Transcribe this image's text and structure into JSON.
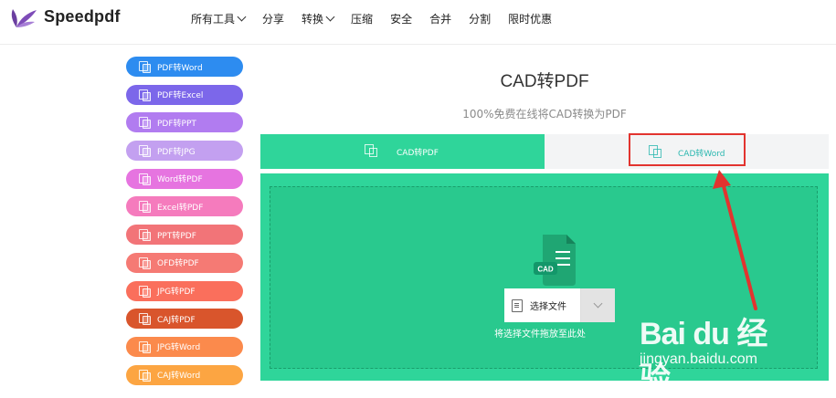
{
  "header": {
    "brand": "Speedpdf",
    "nav": [
      {
        "label": "所有工具",
        "dropdown": true
      },
      {
        "label": "分享",
        "dropdown": false
      },
      {
        "label": "转换",
        "dropdown": true
      },
      {
        "label": "压缩",
        "dropdown": false
      },
      {
        "label": "安全",
        "dropdown": false
      },
      {
        "label": "合并",
        "dropdown": false
      },
      {
        "label": "分割",
        "dropdown": false
      },
      {
        "label": "限时优惠",
        "dropdown": false
      }
    ]
  },
  "sidebar": {
    "items": [
      {
        "label": "PDF转Word",
        "color": "#2d8cf0"
      },
      {
        "label": "PDF转Excel",
        "color": "#7c67ea"
      },
      {
        "label": "PDF转PPT",
        "color": "#b17cf0"
      },
      {
        "label": "PDF转JPG",
        "color": "#c3a0f0"
      },
      {
        "label": "Word转PDF",
        "color": "#e674e0"
      },
      {
        "label": "Excel转PDF",
        "color": "#f57bbd"
      },
      {
        "label": "PPT转PDF",
        "color": "#f27478"
      },
      {
        "label": "OFD转PDF",
        "color": "#f57a74"
      },
      {
        "label": "JPG转PDF",
        "color": "#fa6f5c"
      },
      {
        "label": "CAJ转PDF",
        "color": "#d9552c"
      },
      {
        "label": "JPG转Word",
        "color": "#fb8a4c"
      },
      {
        "label": "CAJ转Word",
        "color": "#fca542"
      }
    ]
  },
  "main": {
    "title": "CAD转PDF",
    "subtitle": "100%免费在线将CAD转换为PDF",
    "tabs": [
      {
        "label": "CAD转PDF",
        "active": true
      },
      {
        "label": "CAD转Word",
        "active": false
      }
    ],
    "upload": {
      "choose_label": "选择文件",
      "drop_hint": "将选择文件拖放至此处",
      "file_icon_text": "CAD"
    }
  },
  "watermark": {
    "logo": "Bai du 经验",
    "url": "jingyan.baidu.com"
  },
  "colors": {
    "accent_green": "#2fd59a",
    "highlight_red": "#e2342f"
  }
}
